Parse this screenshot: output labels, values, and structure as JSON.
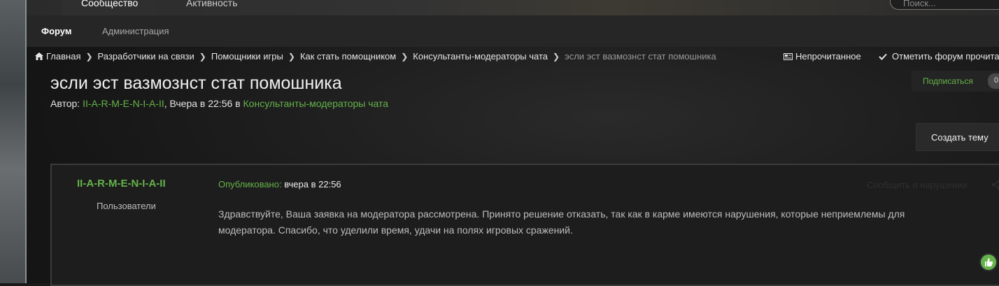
{
  "nav": {
    "main_tabs": [
      {
        "label": "Сообщество",
        "active": true
      },
      {
        "label": "Активность",
        "active": false
      }
    ],
    "search_placeholder": "Поиск...",
    "sub_tabs": [
      {
        "label": "Форум",
        "active": true
      },
      {
        "label": "Администрация",
        "active": false
      }
    ]
  },
  "breadcrumb": {
    "items": [
      "Главная",
      "Разработчики на связи",
      "Помощники игры",
      "Как стать помощником",
      "Консультанты-модераторы чата"
    ],
    "current": "эсли эст вазмознст стат помошника"
  },
  "actions": {
    "unread": "Непрочитанное",
    "mark_read": "Отметить форум прочита",
    "subscribe": "Подписаться",
    "create_topic": "Создать тему"
  },
  "thread": {
    "title": "эсли эст вазмознст стат помошника",
    "meta": {
      "author_label": "Автор:",
      "author": "II-A-R-M-E-N-I-A-II",
      "date": ", Вчера в 22:56",
      "in_label": " в ",
      "forum": "Консультанты-модераторы чата"
    }
  },
  "post": {
    "author": "II-A-R-M-E-N-I-A-II",
    "role": "Пользователи",
    "published_label": "Опубликовано:",
    "published_value": " вчера в 22:56",
    "report": "Сообщить о нарушении",
    "body_line1": "Здравствуйте, Ваша заявка на модератора рассмотрена. Принято решение отказать, так как в карме имеются нарушения, которые неприемлемы для",
    "body_line2": "модератора. Спасибо, что уделили время, удачи на полях игровых сражений."
  },
  "colors": {
    "accent_green": "#65b34a",
    "background": "#1a1a1a"
  }
}
